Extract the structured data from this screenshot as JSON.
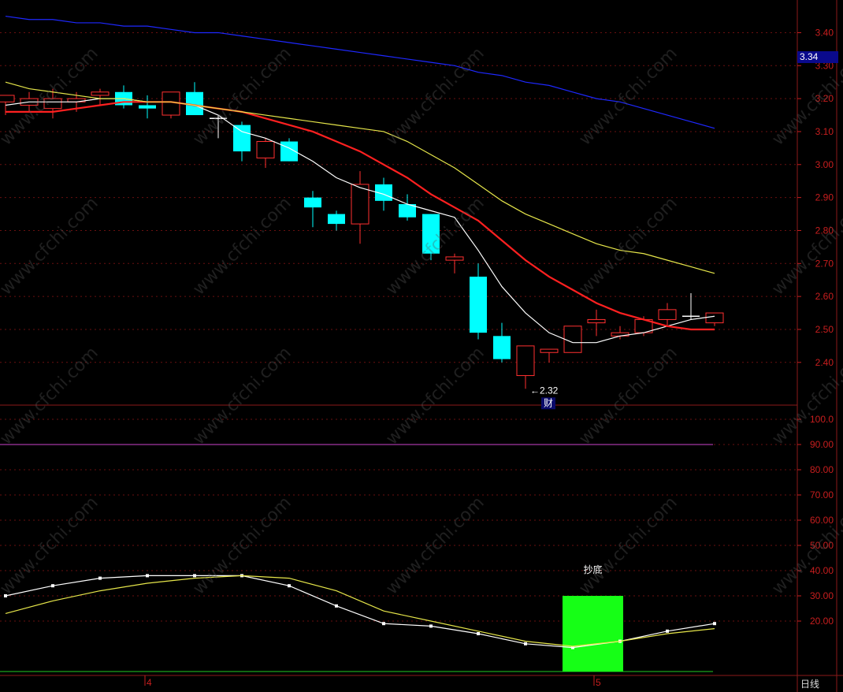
{
  "chart_data": [
    {
      "type": "candlestick",
      "panel": "price",
      "title": "",
      "ylim": [
        2.28,
        3.48
      ],
      "y_ticks": [
        "3.40",
        "3.30",
        "3.20",
        "3.10",
        "3.00",
        "2.90",
        "2.80",
        "2.70",
        "2.60",
        "2.50",
        "2.40"
      ],
      "y_tick_values": [
        3.4,
        3.3,
        3.2,
        3.1,
        3.0,
        2.9,
        2.8,
        2.7,
        2.6,
        2.5,
        2.4
      ],
      "current_price_label": "3.34",
      "low_annotation": "←2.32",
      "event_badge": "财",
      "candles": [
        {
          "o": 3.19,
          "h": 3.21,
          "l": 3.15,
          "c": 3.21
        },
        {
          "o": 3.18,
          "h": 3.22,
          "l": 3.16,
          "c": 3.2
        },
        {
          "o": 3.17,
          "h": 3.23,
          "l": 3.14,
          "c": 3.2
        },
        {
          "o": 3.19,
          "h": 3.22,
          "l": 3.16,
          "c": 3.2
        },
        {
          "o": 3.21,
          "h": 3.23,
          "l": 3.18,
          "c": 3.22
        },
        {
          "o": 3.22,
          "h": 3.24,
          "l": 3.17,
          "c": 3.18
        },
        {
          "o": 3.18,
          "h": 3.21,
          "l": 3.14,
          "c": 3.17
        },
        {
          "o": 3.15,
          "h": 3.22,
          "l": 3.14,
          "c": 3.22
        },
        {
          "o": 3.22,
          "h": 3.25,
          "l": 3.15,
          "c": 3.15
        },
        {
          "o": 3.14,
          "h": 3.15,
          "l": 3.08,
          "c": 3.14
        },
        {
          "o": 3.12,
          "h": 3.13,
          "l": 3.01,
          "c": 3.04
        },
        {
          "o": 3.02,
          "h": 3.08,
          "l": 2.99,
          "c": 3.07
        },
        {
          "o": 3.07,
          "h": 3.08,
          "l": 3.01,
          "c": 3.01
        },
        {
          "o": 2.9,
          "h": 2.92,
          "l": 2.81,
          "c": 2.87
        },
        {
          "o": 2.85,
          "h": 2.86,
          "l": 2.8,
          "c": 2.82
        },
        {
          "o": 2.82,
          "h": 2.98,
          "l": 2.76,
          "c": 2.94
        },
        {
          "o": 2.94,
          "h": 2.96,
          "l": 2.86,
          "c": 2.89
        },
        {
          "o": 2.88,
          "h": 2.91,
          "l": 2.83,
          "c": 2.84
        },
        {
          "o": 2.85,
          "h": 2.85,
          "l": 2.71,
          "c": 2.73
        },
        {
          "o": 2.71,
          "h": 2.73,
          "l": 2.67,
          "c": 2.72
        },
        {
          "o": 2.66,
          "h": 2.7,
          "l": 2.47,
          "c": 2.49
        },
        {
          "o": 2.48,
          "h": 2.52,
          "l": 2.4,
          "c": 2.41
        },
        {
          "o": 2.36,
          "h": 2.45,
          "l": 2.32,
          "c": 2.45
        },
        {
          "o": 2.43,
          "h": 2.44,
          "l": 2.4,
          "c": 2.44
        },
        {
          "o": 2.43,
          "h": 2.51,
          "l": 2.43,
          "c": 2.51
        },
        {
          "o": 2.52,
          "h": 2.56,
          "l": 2.48,
          "c": 2.53
        },
        {
          "o": 2.48,
          "h": 2.51,
          "l": 2.47,
          "c": 2.49
        },
        {
          "o": 2.49,
          "h": 2.54,
          "l": 2.48,
          "c": 2.53
        },
        {
          "o": 2.53,
          "h": 2.58,
          "l": 2.51,
          "c": 2.56
        },
        {
          "o": 2.54,
          "h": 2.61,
          "l": 2.53,
          "c": 2.54
        },
        {
          "o": 2.52,
          "h": 2.55,
          "l": 2.51,
          "c": 2.55
        }
      ],
      "ma_lines": [
        {
          "color": "#ffffff",
          "values": [
            3.18,
            3.19,
            3.19,
            3.19,
            3.2,
            3.2,
            3.19,
            3.19,
            3.18,
            3.15,
            3.1,
            3.08,
            3.05,
            3.01,
            2.96,
            2.93,
            2.91,
            2.88,
            2.86,
            2.84,
            2.74,
            2.63,
            2.55,
            2.49,
            2.46,
            2.46,
            2.48,
            2.49,
            2.51,
            2.53,
            2.54
          ]
        },
        {
          "color": "#ff2020",
          "values": [
            3.16,
            3.16,
            3.16,
            3.17,
            3.18,
            3.19,
            3.19,
            3.19,
            3.18,
            3.17,
            3.16,
            3.14,
            3.12,
            3.1,
            3.07,
            3.04,
            3.0,
            2.96,
            2.91,
            2.87,
            2.83,
            2.77,
            2.71,
            2.66,
            2.62,
            2.58,
            2.55,
            2.53,
            2.51,
            2.5,
            2.5
          ]
        },
        {
          "color": "#e6e64a",
          "values": [
            3.25,
            3.23,
            3.22,
            3.21,
            3.2,
            3.2,
            3.19,
            3.19,
            3.18,
            3.17,
            3.16,
            3.15,
            3.14,
            3.13,
            3.12,
            3.11,
            3.1,
            3.07,
            3.03,
            2.99,
            2.94,
            2.89,
            2.85,
            2.82,
            2.79,
            2.76,
            2.74,
            2.73,
            2.71,
            2.69,
            2.67
          ]
        },
        {
          "color": "#1e28ff",
          "values": [
            3.45,
            3.44,
            3.44,
            3.43,
            3.43,
            3.42,
            3.42,
            3.41,
            3.4,
            3.4,
            3.39,
            3.38,
            3.37,
            3.36,
            3.35,
            3.34,
            3.33,
            3.32,
            3.31,
            3.3,
            3.28,
            3.27,
            3.25,
            3.24,
            3.22,
            3.2,
            3.19,
            3.17,
            3.15,
            3.13,
            3.11
          ]
        }
      ]
    },
    {
      "type": "line",
      "panel": "indicator",
      "ylim": [
        0,
        105
      ],
      "y_ticks": [
        "100.0",
        "90.00",
        "80.00",
        "70.00",
        "60.00",
        "50.00",
        "40.00",
        "30.00",
        "20.00"
      ],
      "y_tick_values": [
        100,
        90,
        80,
        70,
        60,
        50,
        40,
        30,
        20
      ],
      "x_labels": [
        {
          "label": "4",
          "index": 6
        },
        {
          "label": "5",
          "index": 25
        }
      ],
      "reference_line": {
        "value": 90,
        "color": "#cc44cc"
      },
      "signal_bar": {
        "label": "抄底",
        "start_index": 24,
        "end_index": 26,
        "value": 30,
        "color": "#16ff16"
      },
      "series": [
        {
          "color": "#ffffff",
          "markers": true,
          "values": [
            30,
            34,
            37,
            38,
            38,
            38,
            34,
            26,
            19,
            18,
            15,
            11,
            9.5,
            12,
            16,
            19
          ]
        },
        {
          "color": "#e6e64a",
          "markers": false,
          "values": [
            23,
            28,
            32,
            35,
            37,
            38,
            37,
            32,
            24,
            20,
            16,
            12,
            10,
            12,
            15,
            17
          ]
        }
      ],
      "period_label": "日线"
    }
  ]
}
